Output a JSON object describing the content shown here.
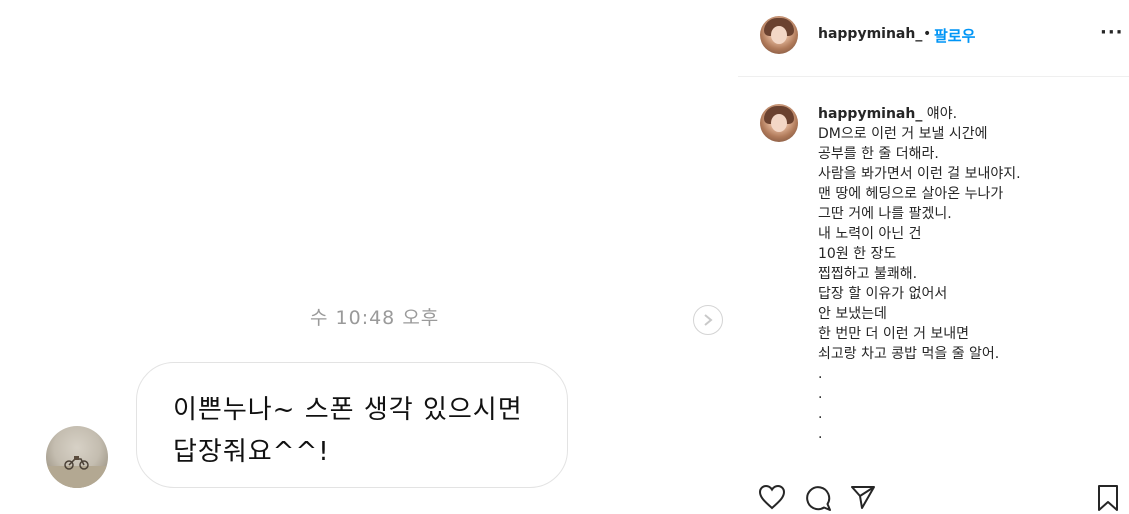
{
  "dm": {
    "timestamp": "수 10:48 오후",
    "message": "이쁜누나~ 스폰 생각 있으시면\n답장줘요^^!",
    "next_icon": "chevron-right-circle-icon"
  },
  "post": {
    "username": "happyminah_",
    "separator": "•",
    "follow_label": "팔로우",
    "more_label": "···",
    "caption": {
      "username": "happyminah_",
      "first_line": " 얘야.",
      "lines": [
        "DM으로 이런 거 보낼 시간에",
        "공부를 한 줄 더해라.",
        "사람을 봐가면서 이런 걸 보내야지.",
        "맨 땅에 헤딩으로 살아온 누나가",
        "그딴 거에 나를 팔겠니.",
        "내 노력이 아닌 건",
        "10원 한 장도",
        "찝찝하고 불쾌해.",
        "답장 할 이유가 없어서",
        "안 보냈는데",
        "한 번만 더 이런 거 보내면",
        "쇠고랑 차고 콩밥 먹을 줄 알어."
      ],
      "dots": [
        ".",
        ".",
        ".",
        "."
      ]
    },
    "actions": {
      "like_icon": "heart-icon",
      "comment_icon": "comment-icon",
      "share_icon": "send-icon",
      "save_icon": "bookmark-icon"
    }
  }
}
